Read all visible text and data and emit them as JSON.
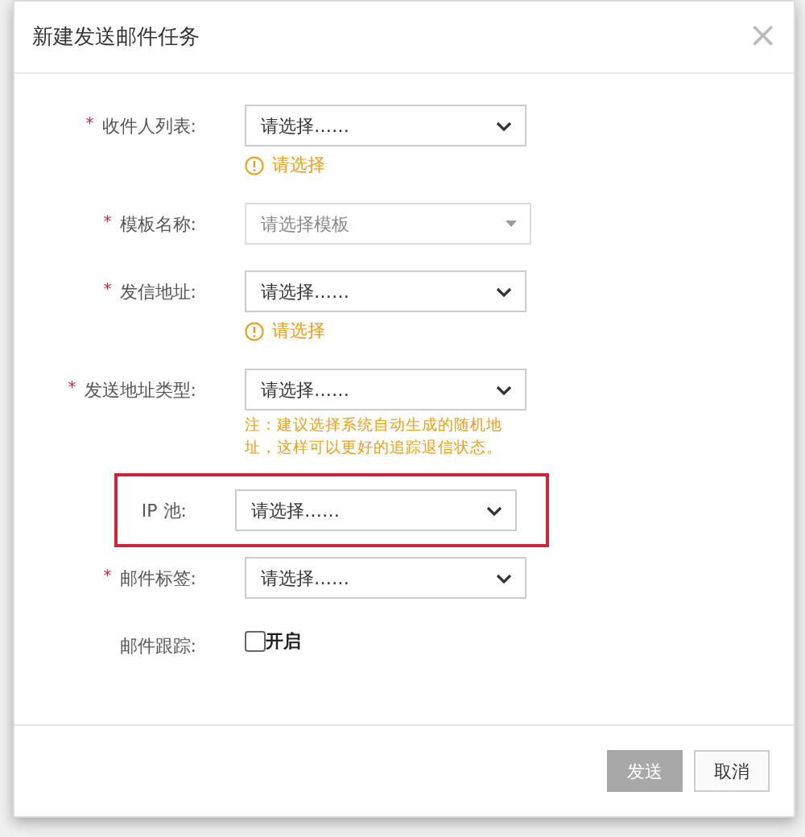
{
  "dialog": {
    "title": "新建发送邮件任务",
    "close": "×"
  },
  "fields": [
    {
      "kind": "select",
      "label": "收件人列表:",
      "required_mark": "*",
      "highlighted": false,
      "value": "请选择……",
      "error": "请选择"
    },
    {
      "kind": "combo",
      "label": "模板名称:",
      "required_mark": "*",
      "highlighted": false,
      "placeholder": "请选择模板"
    },
    {
      "kind": "select",
      "label": "发信地址:",
      "required_mark": "*",
      "highlighted": false,
      "value": "请选择……",
      "error": "请选择"
    },
    {
      "kind": "select",
      "label": "发送地址类型:",
      "required_mark": "*",
      "highlighted": false,
      "value": "请选择……",
      "note": "注：建议选择系统自动生成的随机地址，这样可以更好的追踪退信状态。"
    },
    {
      "kind": "select",
      "label": "IP 池:",
      "highlighted": true,
      "value": "请选择……"
    },
    {
      "kind": "select",
      "label": "邮件标签:",
      "required_mark": "*",
      "highlighted": false,
      "value": "请选择……"
    },
    {
      "kind": "checkbox",
      "label": "邮件跟踪:",
      "highlighted": false,
      "checked": false,
      "text": "开启"
    }
  ],
  "buttons": [
    {
      "label": "发送",
      "disabled": true
    },
    {
      "label": "取消",
      "disabled": false
    }
  ]
}
